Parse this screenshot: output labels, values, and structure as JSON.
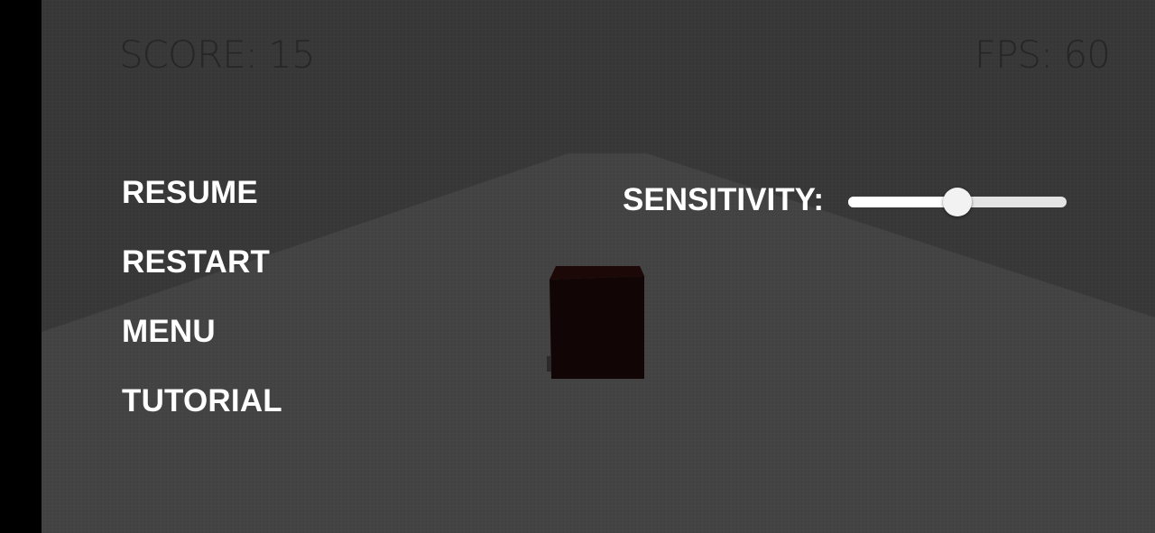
{
  "hud": {
    "score_text": "SCORE: 15",
    "fps_text": "FPS: 60",
    "text_color": "#262626"
  },
  "pause_menu": {
    "items": [
      {
        "label": "RESUME"
      },
      {
        "label": "RESTART"
      },
      {
        "label": "MENU"
      },
      {
        "label": "TUTORIAL"
      }
    ]
  },
  "settings": {
    "sensitivity_label": "SENSITIVITY:",
    "sensitivity_value": 0.5
  },
  "scene": {
    "sky_color": "#383838",
    "floor_color": "#434343",
    "cube_color": "#120505"
  }
}
